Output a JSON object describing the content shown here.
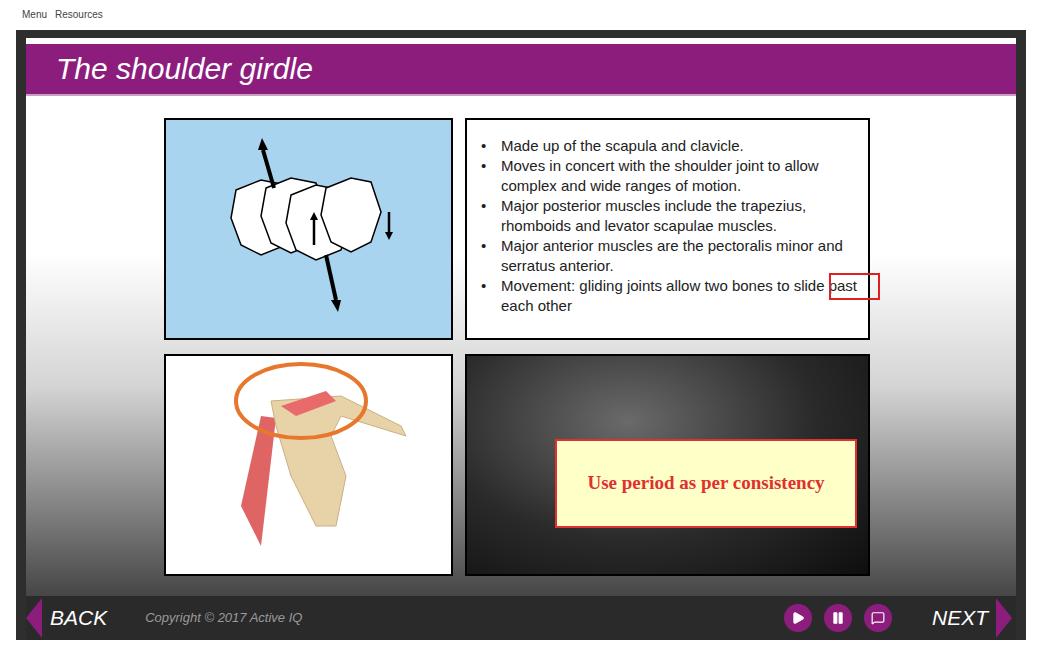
{
  "header": {
    "links": [
      "Menu",
      "Resources"
    ]
  },
  "slide": {
    "title": "The shoulder girdle",
    "bullets": [
      "Made up of the scapula and clavicle.",
      "Moves in concert with the shoulder joint to allow complex and wide ranges of motion.",
      "Major posterior muscles include the trapezius, rhomboids and levator scapulae muscles.",
      "Major anterior muscles are the pectoralis minor and serratus anterior.",
      "Movement: gliding joints allow two bones to slide past each other"
    ]
  },
  "annotation": {
    "text": "Use period as per consistency"
  },
  "footer": {
    "back": "BACK",
    "copyright": "Copyright © 2017 Active IQ",
    "next": "NEXT"
  }
}
